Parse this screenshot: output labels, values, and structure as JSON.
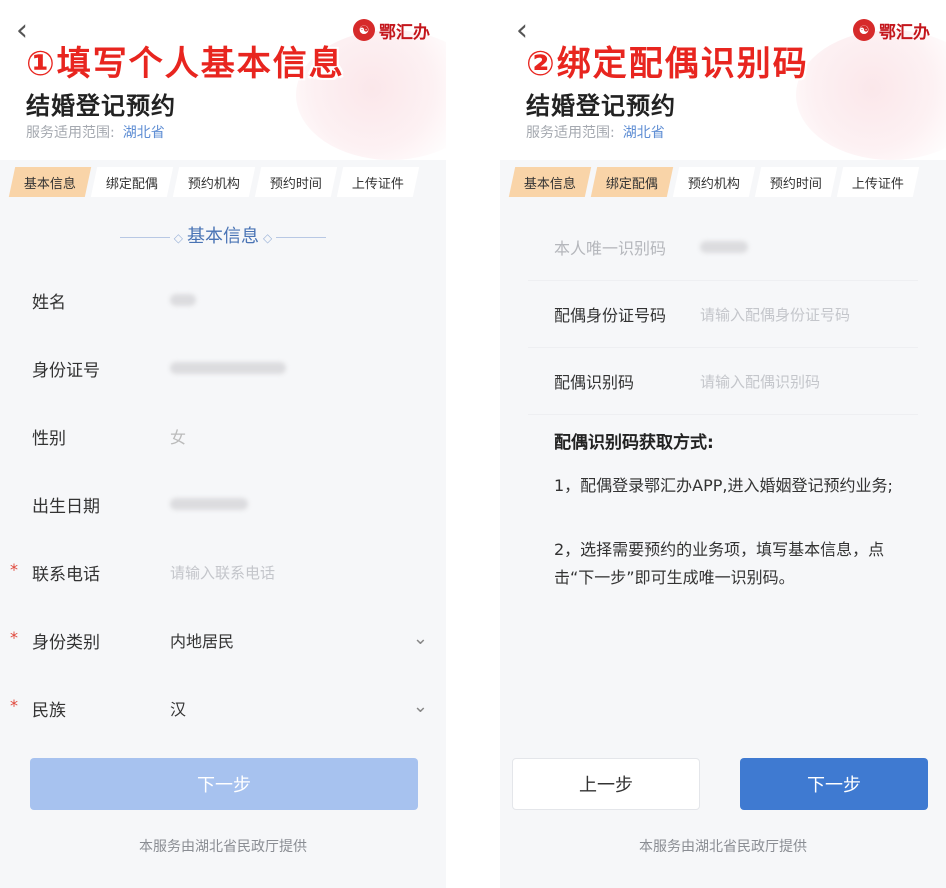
{
  "brand": {
    "logo_text": "鄂汇办",
    "accent": "#3f7ad1",
    "step_active_color": "#f9d4a8",
    "overlay_color": "#e8251f"
  },
  "steps": [
    "基本信息",
    "绑定配偶",
    "预约机构",
    "预约时间",
    "上传证件"
  ],
  "screen1": {
    "overlay_title": "①填写个人基本信息",
    "title": "结婚登记预约",
    "scope_label": "服务适用范围:",
    "scope_value": "湖北省",
    "section_title": "基本信息",
    "fields": [
      {
        "label": "姓名",
        "required": false
      },
      {
        "label": "身份证号",
        "required": false
      },
      {
        "label": "性别",
        "value": "女",
        "required": false
      },
      {
        "label": "出生日期",
        "required": false
      },
      {
        "label": "联系电话",
        "placeholder": "请输入联系电话",
        "required": true
      },
      {
        "label": "身份类别",
        "value": "内地居民",
        "required": true
      },
      {
        "label": "民族",
        "value": "汉",
        "required": true
      }
    ],
    "next_label": "下一步",
    "footer": "本服务由湖北省民政厅提供"
  },
  "screen2": {
    "overlay_title": "②绑定配偶识别码",
    "title": "结婚登记预约",
    "scope_label": "服务适用范围:",
    "scope_value": "湖北省",
    "fields": [
      {
        "label": "本人唯一识别码"
      },
      {
        "label": "配偶身份证号码",
        "placeholder": "请输入配偶身份证号码"
      },
      {
        "label": "配偶识别码",
        "placeholder": "请输入配偶识别码"
      }
    ],
    "how_title": "配偶识别码获取方式:",
    "how_items": [
      "1，配偶登录鄂汇办APP,进入婚姻登记预约业务;",
      "2，选择需要预约的业务项，填写基本信息，点击“下一步”即可生成唯一识别码。"
    ],
    "prev_label": "上一步",
    "next_label": "下一步",
    "footer": "本服务由湖北省民政厅提供"
  }
}
